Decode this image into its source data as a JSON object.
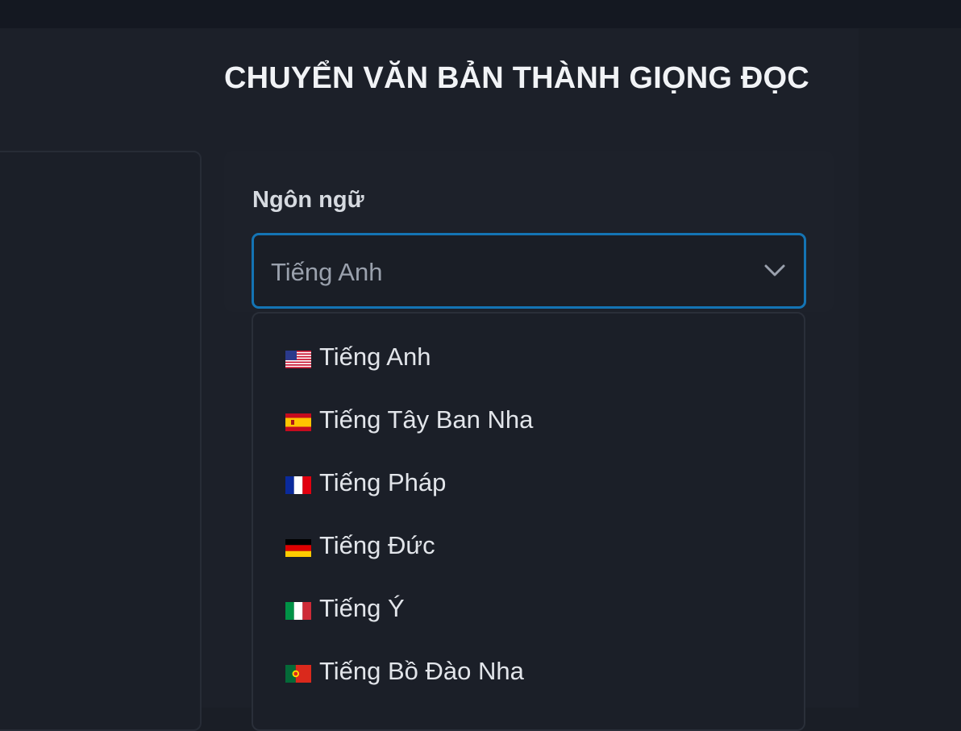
{
  "page": {
    "title": "CHUYỂN VĂN BẢN THÀNH GIỌNG ĐỌC"
  },
  "language_field": {
    "label": "Ngôn ngữ",
    "selected": "Tiếng Anh"
  },
  "dropdown": {
    "options": [
      {
        "label": "Tiếng Anh",
        "flag": "us-flag-icon"
      },
      {
        "label": "Tiếng Tây Ban Nha",
        "flag": "es-flag-icon"
      },
      {
        "label": "Tiếng Pháp",
        "flag": "fr-flag-icon"
      },
      {
        "label": "Tiếng Đức",
        "flag": "de-flag-icon"
      },
      {
        "label": "Tiếng Ý",
        "flag": "it-flag-icon"
      },
      {
        "label": "Tiếng Bồ Đào Nha",
        "flag": "pt-flag-icon"
      }
    ]
  },
  "colors": {
    "accent_border": "#1474b4",
    "background": "#1c2029",
    "text_primary": "#f1f3f6",
    "text_muted": "#9aa1ad"
  }
}
